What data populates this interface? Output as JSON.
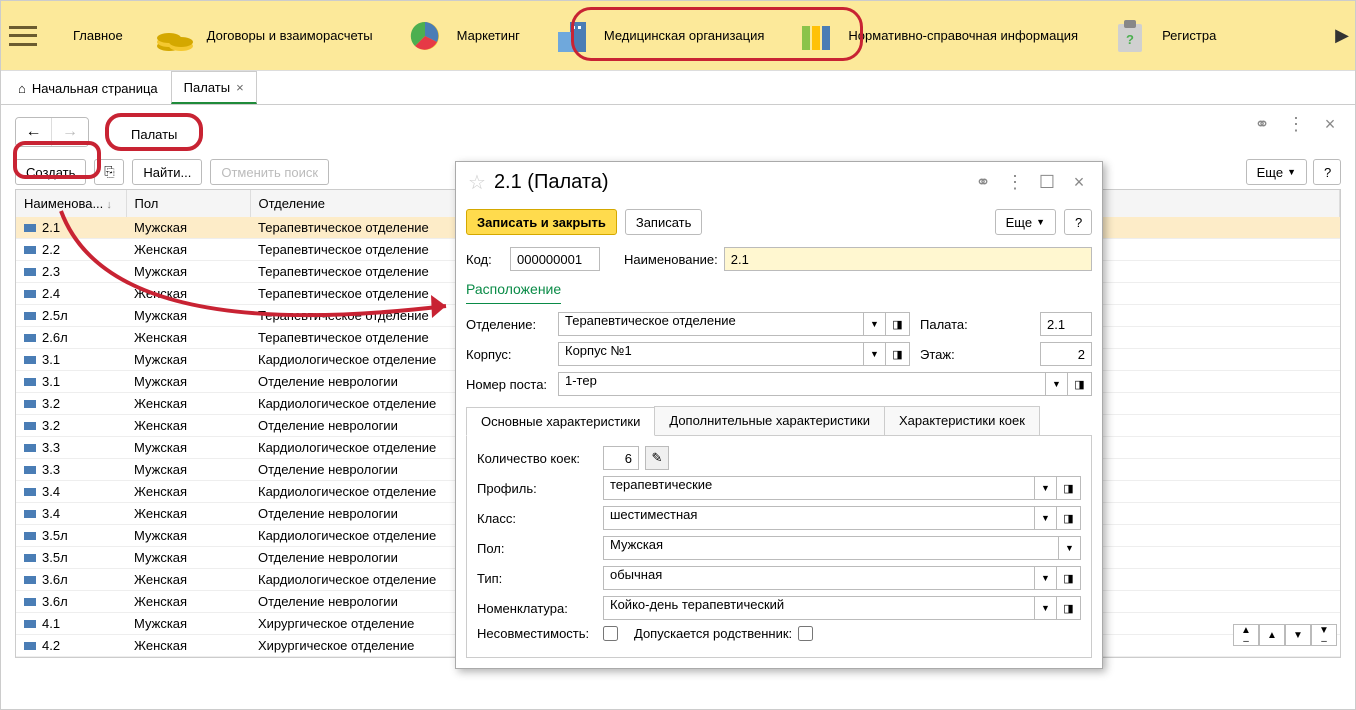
{
  "nav": {
    "items": [
      {
        "label": "Главное"
      },
      {
        "label": "Договоры и взаиморасчеты"
      },
      {
        "label": "Маркетинг"
      },
      {
        "label": "Медицинская организация"
      },
      {
        "label": "Нормативно-справочная информация"
      },
      {
        "label": "Регистра"
      }
    ]
  },
  "tabs": {
    "home": "Начальная страница",
    "active": "Палаты"
  },
  "page": {
    "title": "Палаты"
  },
  "toolbar": {
    "create": "Создать",
    "find": "Найти...",
    "cancel_search": "Отменить поиск",
    "more": "Еще",
    "help": "?"
  },
  "table": {
    "cols": {
      "name": "Наименова...",
      "sex": "Пол",
      "dept": "Отделение"
    },
    "rows": [
      {
        "name": "2.1",
        "sex": "Мужская",
        "dept": "Терапевтическое отделение",
        "sel": true
      },
      {
        "name": "2.2",
        "sex": "Женская",
        "dept": "Терапевтическое отделение"
      },
      {
        "name": "2.3",
        "sex": "Мужская",
        "dept": "Терапевтическое отделение"
      },
      {
        "name": "2.4",
        "sex": "Женская",
        "dept": "Терапевтическое отделение"
      },
      {
        "name": "2.5л",
        "sex": "Мужская",
        "dept": "Терапевтическое отделение"
      },
      {
        "name": "2.6л",
        "sex": "Женская",
        "dept": "Терапевтическое отделение"
      },
      {
        "name": "3.1",
        "sex": "Мужская",
        "dept": "Кардиологическое отделение"
      },
      {
        "name": "3.1",
        "sex": "Мужская",
        "dept": "Отделение неврологии"
      },
      {
        "name": "3.2",
        "sex": "Женская",
        "dept": "Кардиологическое отделение"
      },
      {
        "name": "3.2",
        "sex": "Женская",
        "dept": "Отделение неврологии"
      },
      {
        "name": "3.3",
        "sex": "Мужская",
        "dept": "Кардиологическое отделение"
      },
      {
        "name": "3.3",
        "sex": "Мужская",
        "dept": "Отделение неврологии"
      },
      {
        "name": "3.4",
        "sex": "Женская",
        "dept": "Кардиологическое отделение"
      },
      {
        "name": "3.4",
        "sex": "Женская",
        "dept": "Отделение неврологии"
      },
      {
        "name": "3.5л",
        "sex": "Мужская",
        "dept": "Кардиологическое отделение"
      },
      {
        "name": "3.5л",
        "sex": "Мужская",
        "dept": "Отделение неврологии"
      },
      {
        "name": "3.6л",
        "sex": "Женская",
        "dept": "Кардиологическое отделение"
      },
      {
        "name": "3.6л",
        "sex": "Женская",
        "dept": "Отделение неврологии"
      },
      {
        "name": "4.1",
        "sex": "Мужская",
        "dept": "Хирургическое отделение"
      },
      {
        "name": "4.2",
        "sex": "Женская",
        "dept": "Хирургическое отделение"
      }
    ]
  },
  "modal": {
    "title": "2.1 (Палата)",
    "save_close": "Записать и закрыть",
    "save": "Записать",
    "more": "Еще",
    "help": "?",
    "labels": {
      "code": "Код:",
      "name": "Наименование:",
      "location": "Расположение",
      "dept": "Отделение:",
      "ward": "Палата:",
      "building": "Корпус:",
      "floor": "Этаж:",
      "post": "Номер поста:",
      "beds": "Количество коек:",
      "profile": "Профиль:",
      "class": "Класс:",
      "sex": "Пол:",
      "type": "Тип:",
      "nomen": "Номенклатура:",
      "incompat": "Несовместимость:",
      "relative": "Допускается родственник:"
    },
    "values": {
      "code": "000000001",
      "name": "2.1",
      "dept": "Терапевтическое отделение",
      "ward": "2.1",
      "building": "Корпус №1",
      "floor": "2",
      "post": "1-тер",
      "beds": "6",
      "profile": "терапевтические",
      "class": "шестиместная",
      "sex": "Мужская",
      "type": "обычная",
      "nomen": "Койко-день терапевтический"
    },
    "mtabs": [
      "Основные характеристики",
      "Дополнительные характеристики",
      "Характеристики коек"
    ]
  }
}
